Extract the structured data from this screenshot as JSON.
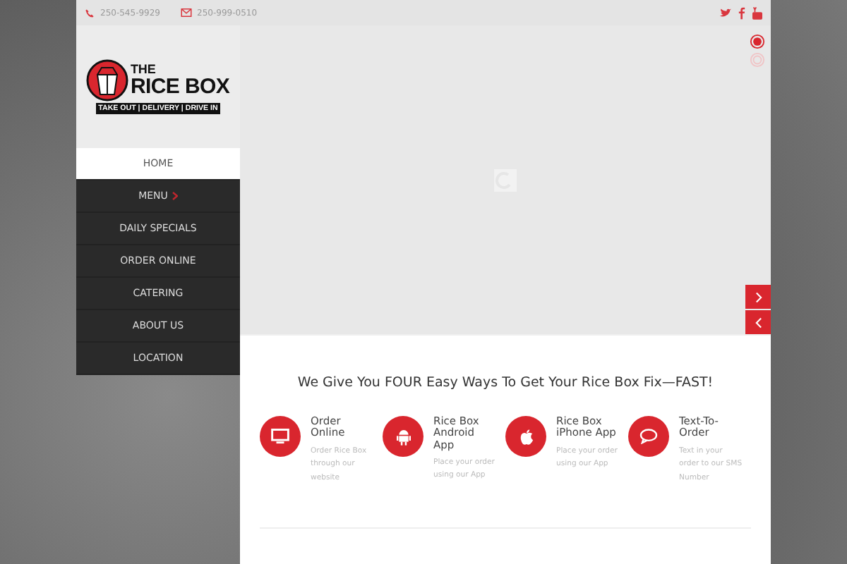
{
  "top_bar": {
    "phone": "250-545-9929",
    "fax": "250-999-0510"
  },
  "logo": {
    "line1": "THE",
    "line2": "RICE BOX",
    "tagline": "TAKE OUT | DELIVERY | DRIVE IN"
  },
  "nav": [
    {
      "label": "HOME",
      "selected": true,
      "submenu": false
    },
    {
      "label": "MENU",
      "selected": false,
      "submenu": true
    },
    {
      "label": "DAILY SPECIALS",
      "selected": false,
      "submenu": false
    },
    {
      "label": "ORDER ONLINE",
      "selected": false,
      "submenu": false
    },
    {
      "label": "CATERING",
      "selected": false,
      "submenu": false
    },
    {
      "label": "ABOUT US",
      "selected": false,
      "submenu": false
    },
    {
      "label": "LOCATION",
      "selected": false,
      "submenu": false
    }
  ],
  "slider": {
    "dots": [
      {
        "selected": true
      },
      {
        "selected": false
      }
    ]
  },
  "heading": "We Give You FOUR Easy Ways To Get Your Rice Box Fix—FAST!",
  "features": [
    {
      "kind": "monitor",
      "title": "Order Online",
      "text": "Order Rice Box through our website"
    },
    {
      "kind": "android",
      "title": "Rice Box Android App",
      "text": "Place your order using our App"
    },
    {
      "kind": "apple",
      "title": "Rice Box iPhone App",
      "text": "Place your order using our App"
    },
    {
      "kind": "chat",
      "title": "Text-To-Order",
      "text": "Text in your order to our SMS Number"
    }
  ]
}
